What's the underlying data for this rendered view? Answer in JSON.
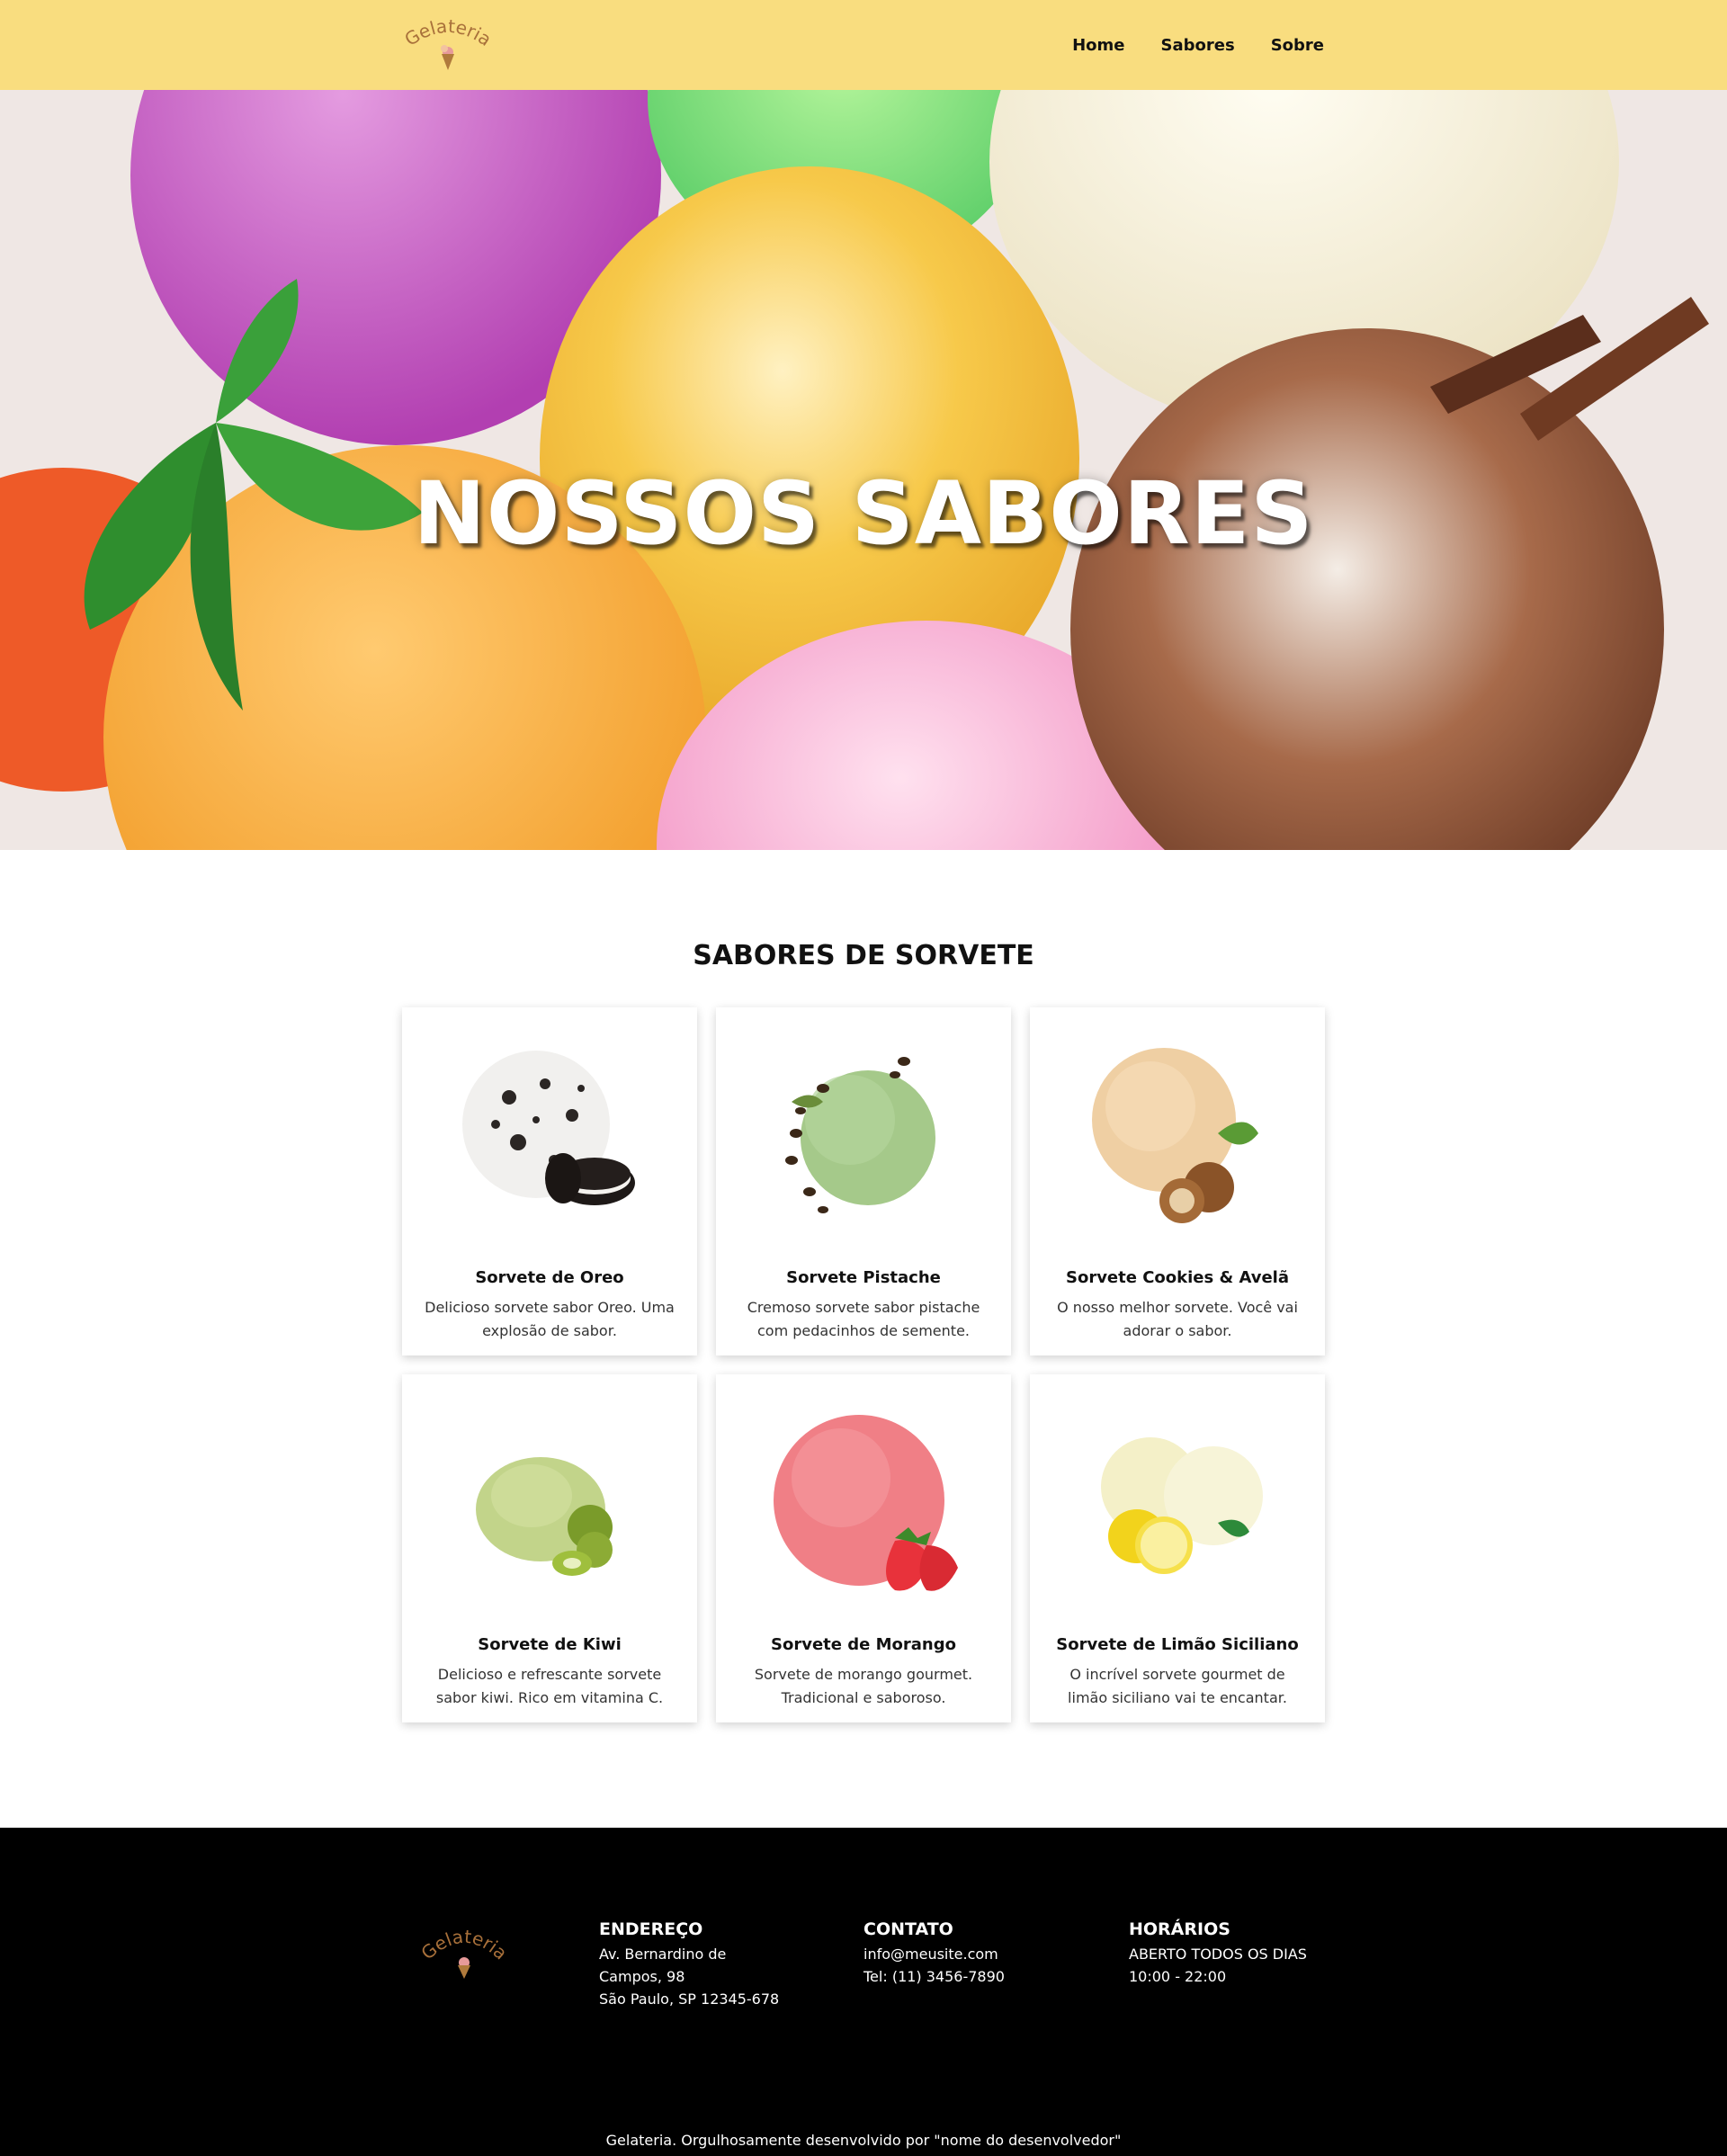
{
  "header": {
    "logo_text": "Gelateria",
    "nav": [
      "Home",
      "Sabores",
      "Sobre"
    ]
  },
  "hero": {
    "title": "NOSSOS SABORES"
  },
  "flavors": {
    "title": "SABORES DE SORVETE",
    "items": [
      {
        "name": "Sorvete de Oreo",
        "description": "Delicioso sorvete sabor Oreo. Uma explosão de sabor.",
        "image": "oreo-ice-cream"
      },
      {
        "name": "Sorvete Pistache",
        "description": "Cremoso sorvete sabor pistache com pedacinhos de semente.",
        "image": "pistachio-ice-cream"
      },
      {
        "name": "Sorvete Cookies & Avelã",
        "description": "O nosso melhor sorvete. Você vai adorar o sabor.",
        "image": "hazelnut-ice-cream"
      },
      {
        "name": "Sorvete de Kiwi",
        "description": "Delicioso e refrescante sorvete sabor kiwi. Rico em vitamina C.",
        "image": "kiwi-ice-cream"
      },
      {
        "name": "Sorvete de Morango",
        "description": "Sorvete de morango gourmet. Tradicional e saboroso.",
        "image": "strawberry-ice-cream"
      },
      {
        "name": "Sorvete de Limão Siciliano",
        "description": "O incrível sorvete gourmet de limão siciliano vai te encantar.",
        "image": "lemon-ice-cream"
      }
    ]
  },
  "footer": {
    "logo_text": "Gelateria",
    "address": {
      "title": "ENDEREÇO",
      "line1": "Av. Bernardino de",
      "line2": "Campos, 98",
      "line3": "São Paulo, SP 12345-678"
    },
    "contact": {
      "title": "CONTATO",
      "email": "info@meusite.com",
      "phone": "Tel: (11) 3456-7890"
    },
    "hours": {
      "title": "HORÁRIOS",
      "line1": "ABERTO TODOS OS DIAS",
      "line2": "10:00 - 22:00"
    },
    "credit": "Gelateria. Orgulhosamente desenvolvido por \"nome do desenvolvedor\""
  },
  "colors": {
    "header_bg": "#f9dd7f",
    "footer_bg": "#000000",
    "logo_brown": "#a8703a"
  }
}
